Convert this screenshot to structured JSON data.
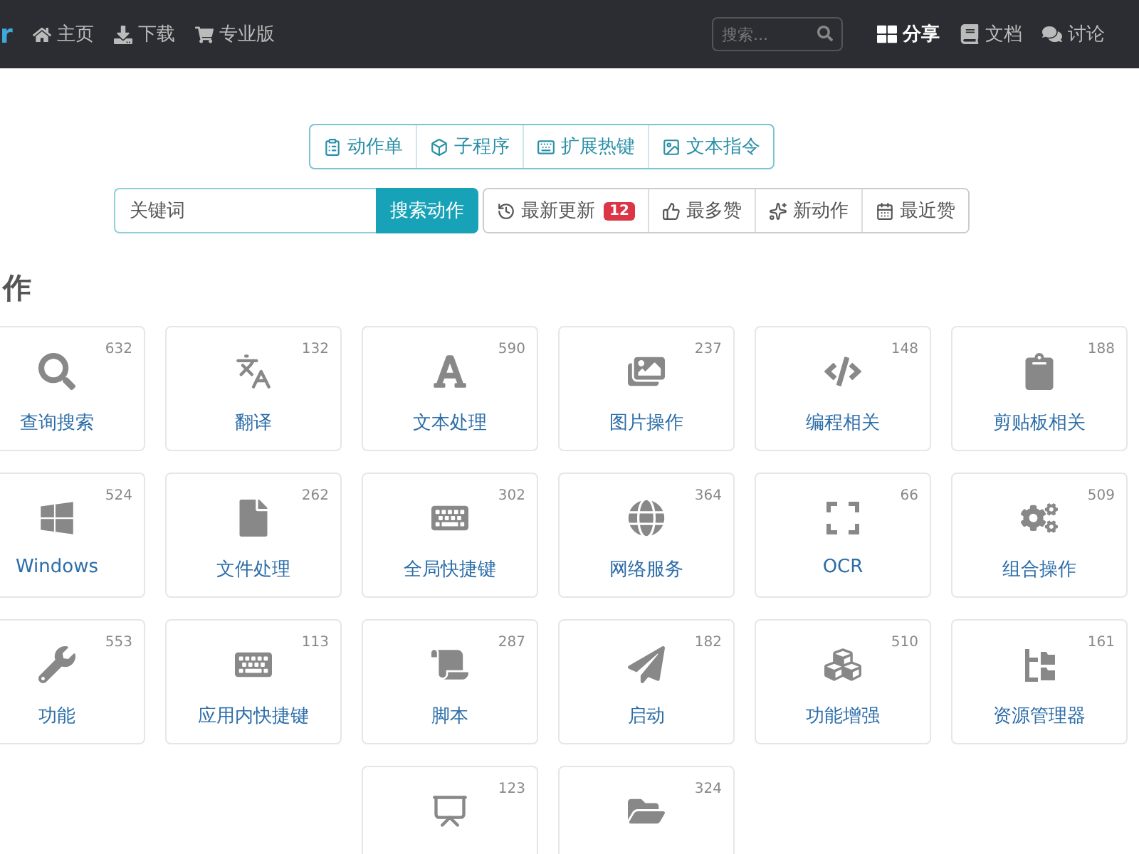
{
  "navbar": {
    "brand": "r",
    "links": [
      {
        "label": "主页"
      },
      {
        "label": "下载"
      },
      {
        "label": "专业版"
      }
    ],
    "search": {
      "placeholder": "搜索..."
    },
    "right_links": [
      {
        "label": "分享",
        "selected": true
      },
      {
        "label": "文档",
        "selected": false
      },
      {
        "label": "讨论",
        "selected": false
      }
    ]
  },
  "type_tabs": [
    {
      "label": "动作单"
    },
    {
      "label": "子程序"
    },
    {
      "label": "扩展热键"
    },
    {
      "label": "文本指令"
    }
  ],
  "search": {
    "placeholder": "关键词",
    "button": "搜索动作"
  },
  "sort_buttons": [
    {
      "label": "最新更新",
      "badge": "12"
    },
    {
      "label": "最多赞"
    },
    {
      "label": "新动作"
    },
    {
      "label": "最近赞"
    }
  ],
  "section_title": "作",
  "categories": [
    {
      "name": "查询搜索",
      "count": "632"
    },
    {
      "name": "翻译",
      "count": "132"
    },
    {
      "name": "文本处理",
      "count": "590"
    },
    {
      "name": "图片操作",
      "count": "237"
    },
    {
      "name": "编程相关",
      "count": "148"
    },
    {
      "name": "剪贴板相关",
      "count": "188"
    },
    {
      "name": "Windows",
      "count": "524"
    },
    {
      "name": "文件处理",
      "count": "262"
    },
    {
      "name": "全局快捷键",
      "count": "302"
    },
    {
      "name": "网络服务",
      "count": "364"
    },
    {
      "name": "OCR",
      "count": "66"
    },
    {
      "name": "组合操作",
      "count": "509"
    },
    {
      "name": "功能",
      "count": "553"
    },
    {
      "name": "应用内快捷键",
      "count": "113"
    },
    {
      "name": "脚本",
      "count": "287"
    },
    {
      "name": "启动",
      "count": "182"
    },
    {
      "name": "功能增强",
      "count": "510"
    },
    {
      "name": "资源管理器",
      "count": "161"
    },
    {
      "count": "123"
    },
    {
      "count": "324"
    }
  ]
}
